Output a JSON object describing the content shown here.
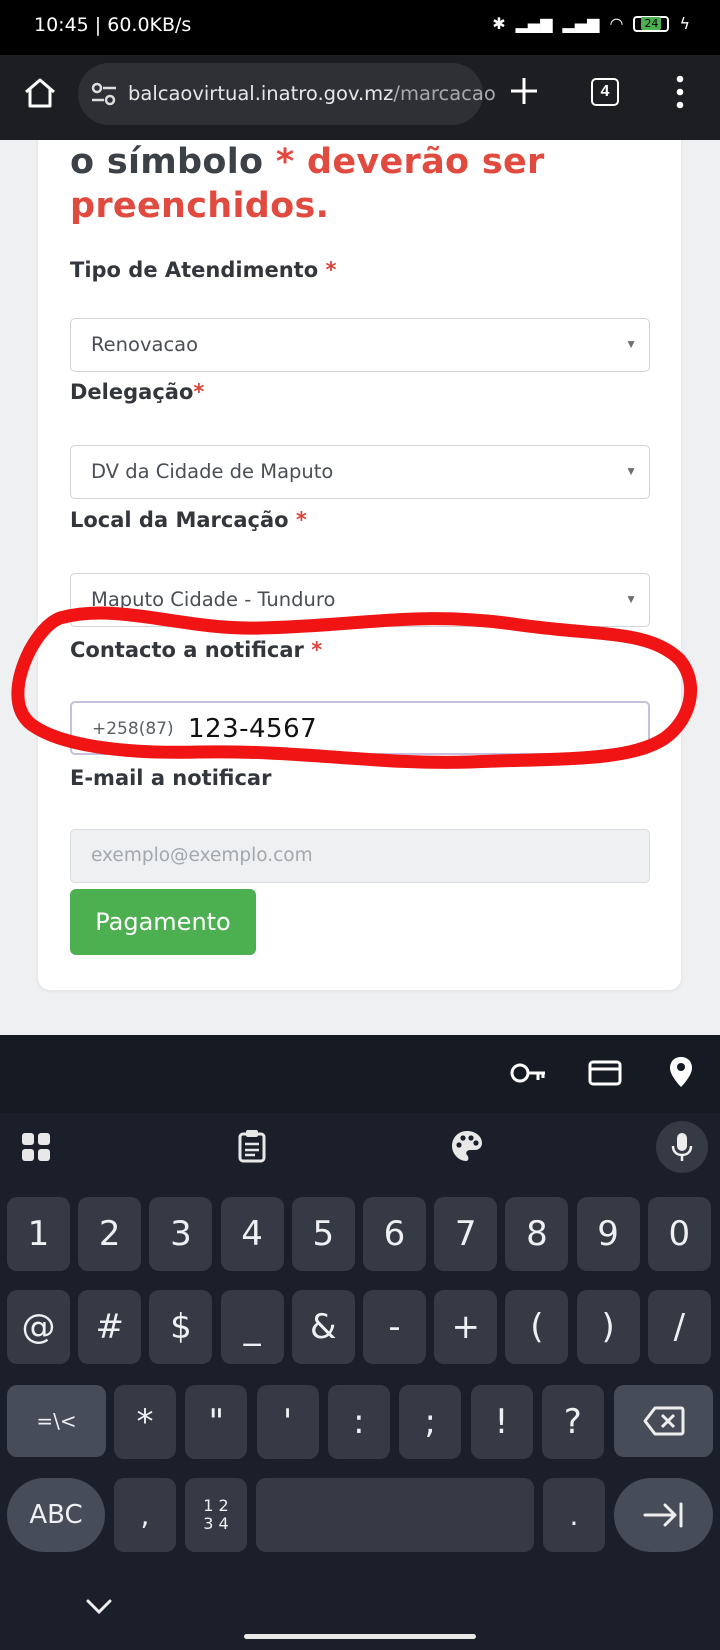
{
  "status_bar": {
    "time": "10:45 | 60.0KB/s",
    "battery": "24"
  },
  "browser": {
    "url_domain": "balcaovirtual.inatro.gov.mz",
    "url_path": "/marcacao",
    "tab_count": "4"
  },
  "form": {
    "heading_prefix": "o símbolo",
    "heading_required": "* deverão ser preenchidos.",
    "tipo_label": "Tipo de Atendimento",
    "tipo_value": "Renovacao",
    "delegacao_label": "Delegação",
    "delegacao_value": "DV da Cidade de Maputo",
    "local_label": "Local da Marcação",
    "local_value": "Maputo Cidade - Tunduro",
    "contacto_label": "Contacto a notificar",
    "contacto_prefix": "+258(87)",
    "contacto_value": "123-4567",
    "email_label": "E-mail a notificar",
    "email_placeholder": "exemplo@exemplo.com",
    "required_star": "*",
    "pay_button": "Pagamento"
  },
  "keyboard": {
    "row1": [
      "1",
      "2",
      "3",
      "4",
      "5",
      "6",
      "7",
      "8",
      "9",
      "0"
    ],
    "row2": [
      "@",
      "#",
      "$",
      "_",
      "&",
      "-",
      "+",
      "(",
      ")",
      "/"
    ],
    "row3_mode": "=\\<",
    "row3": [
      "*",
      "\"",
      "'",
      ":",
      ";",
      "!",
      "?"
    ],
    "abc": "ABC",
    "comma": ",",
    "numpad": "1 2\n3 4",
    "period": "."
  },
  "colors": {
    "accent_required": "#e04a3f",
    "button_green": "#4caf50",
    "annotation_red": "#f01414"
  }
}
